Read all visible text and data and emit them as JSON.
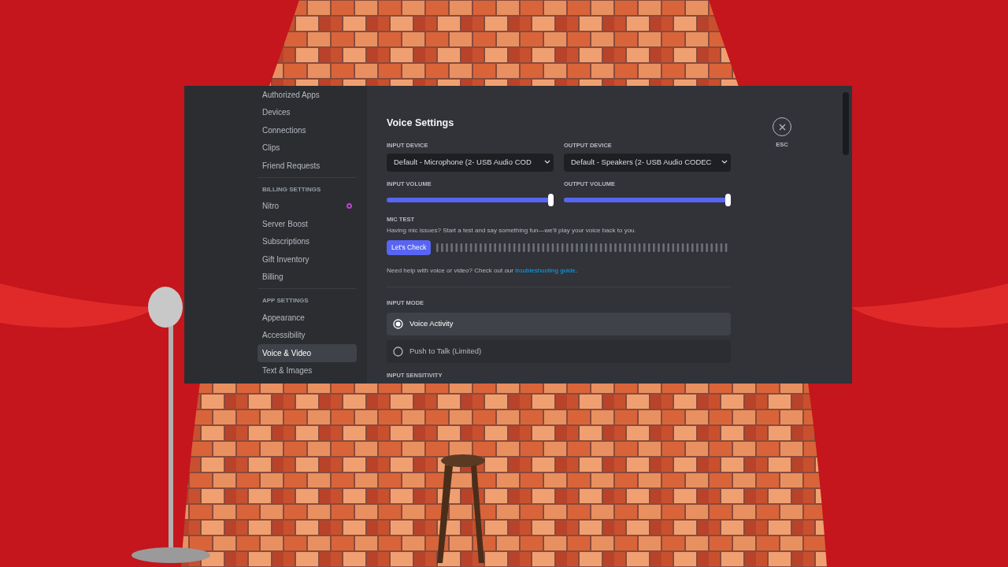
{
  "sidebar": {
    "sections": [
      {
        "items": [
          {
            "label": "Authorized Apps",
            "selected": false
          },
          {
            "label": "Devices",
            "selected": false
          },
          {
            "label": "Connections",
            "selected": false
          },
          {
            "label": "Clips",
            "selected": false
          },
          {
            "label": "Friend Requests",
            "selected": false
          }
        ]
      },
      {
        "heading": "BILLING SETTINGS",
        "items": [
          {
            "label": "Nitro",
            "selected": false,
            "badge": true
          },
          {
            "label": "Server Boost",
            "selected": false
          },
          {
            "label": "Subscriptions",
            "selected": false
          },
          {
            "label": "Gift Inventory",
            "selected": false
          },
          {
            "label": "Billing",
            "selected": false
          }
        ]
      },
      {
        "heading": "APP SETTINGS",
        "items": [
          {
            "label": "Appearance",
            "selected": false
          },
          {
            "label": "Accessibility",
            "selected": false
          },
          {
            "label": "Voice & Video",
            "selected": true
          },
          {
            "label": "Text & Images",
            "selected": false
          }
        ]
      }
    ]
  },
  "title": "Voice Settings",
  "close": {
    "label": "ESC"
  },
  "devices": [
    {
      "label": "INPUT DEVICE",
      "value": "Default - Microphone (2- USB Audio COD"
    },
    {
      "label": "OUTPUT DEVICE",
      "value": "Default - Speakers (2- USB Audio CODEC"
    }
  ],
  "volumes": [
    {
      "label": "INPUT VOLUME",
      "level": 1.0
    },
    {
      "label": "OUTPUT VOLUME",
      "level": 1.0
    }
  ],
  "mic_test": {
    "heading": "MIC TEST",
    "description": "Having mic issues? Start a test and say something fun—we'll play your voice back to you.",
    "button": "Let's Check",
    "help": "Need help with voice or video? Check out our ",
    "link": "troubleshooting guide",
    "after_link": "."
  },
  "input_mode": {
    "heading": "INPUT MODE",
    "options": [
      {
        "label": "Voice Activity",
        "selected": true
      },
      {
        "label": "Push to Talk (Limited)",
        "selected": false
      }
    ]
  },
  "next_heading": "INPUT SENSITIVITY"
}
